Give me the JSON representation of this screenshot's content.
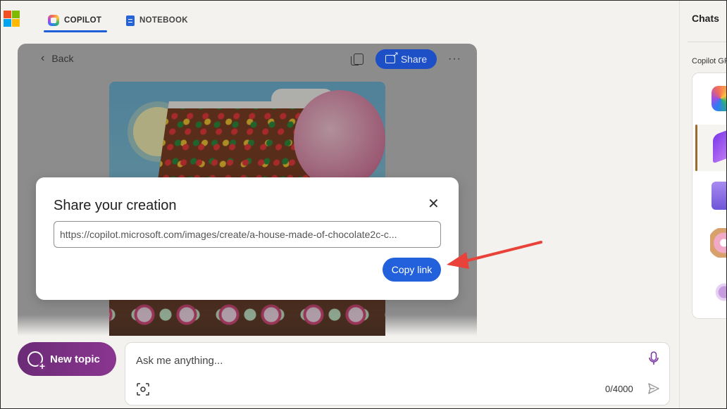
{
  "header": {
    "tabs": [
      {
        "label": "COPILOT",
        "icon": "copilot-icon",
        "active": true
      },
      {
        "label": "NOTEBOOK",
        "icon": "notebook-icon",
        "active": false
      }
    ]
  },
  "sidebar": {
    "title": "Chats",
    "gpts_label": "Copilot GPTs",
    "items": [
      {
        "icon": "copilot-gpt-icon"
      },
      {
        "icon": "designer-gpt-icon",
        "active": true
      },
      {
        "icon": "vacation-planner-gpt-icon"
      },
      {
        "icon": "cooking-gpt-icon"
      },
      {
        "icon": "fitness-gpt-icon"
      }
    ]
  },
  "image_viewer": {
    "back_label": "Back",
    "share_label": "Share",
    "more_label": "···"
  },
  "share_dialog": {
    "title": "Share your creation",
    "url": "https://copilot.microsoft.com/images/create/a-house-made-of-chocolate2c-c...",
    "copy_label": "Copy link",
    "close_glyph": "✕"
  },
  "composer": {
    "new_topic_label": "New topic",
    "placeholder": "Ask me anything...",
    "char_count": "0/4000"
  },
  "colors": {
    "accent": "#2360db",
    "share_button": "#1d4fc7",
    "new_topic": "#7a3083",
    "annotation_arrow": "#e8423a"
  }
}
